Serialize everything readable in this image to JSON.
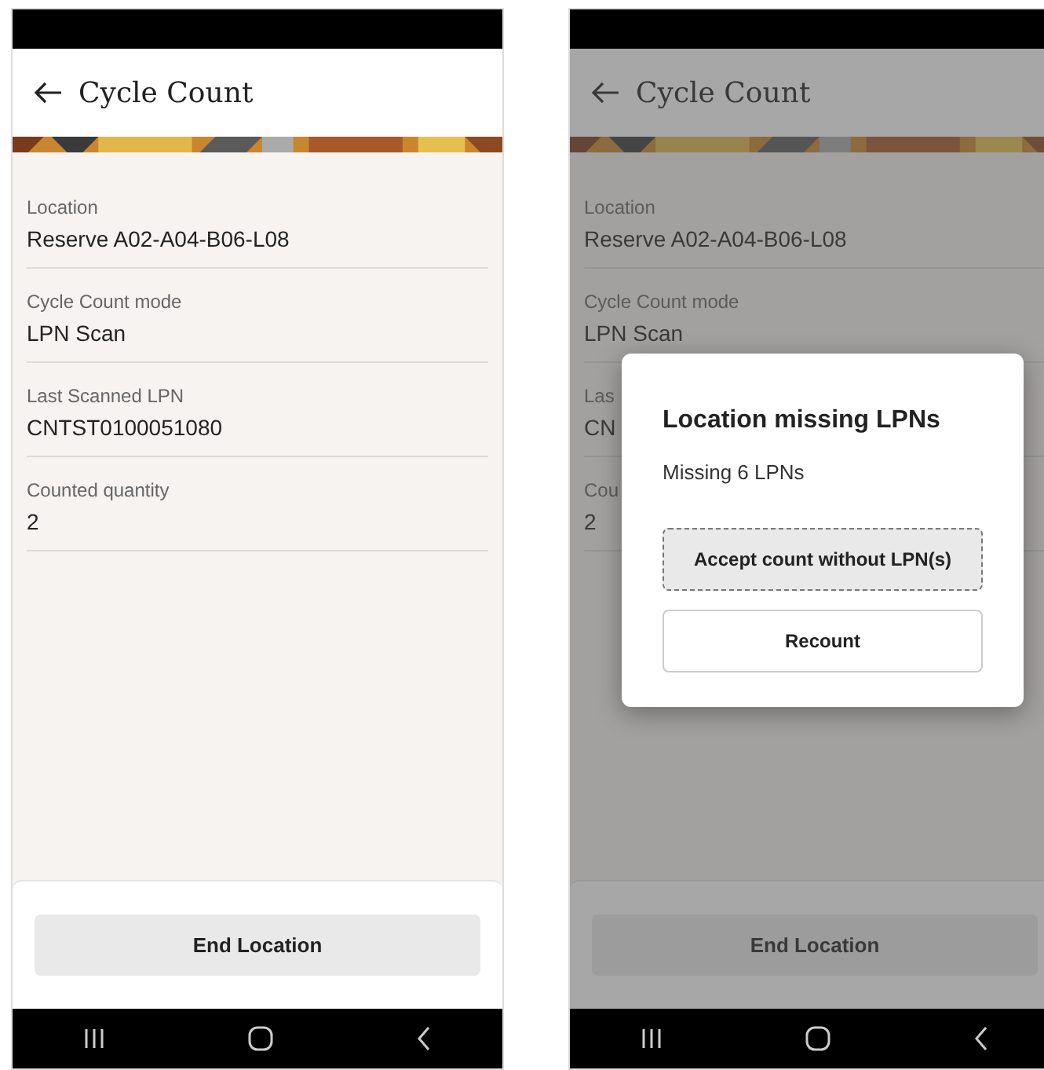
{
  "screens": [
    {
      "header": {
        "title": "Cycle Count"
      },
      "fields": [
        {
          "label": "Location",
          "value": "Reserve A02-A04-B06-L08"
        },
        {
          "label": "Cycle Count mode",
          "value": "LPN Scan"
        },
        {
          "label": "Last Scanned LPN",
          "value": "CNTST0100051080"
        },
        {
          "label": "Counted quantity",
          "value": "2"
        }
      ],
      "footer_button": "End Location"
    },
    {
      "header": {
        "title": "Cycle Count"
      },
      "fields": [
        {
          "label": "Location",
          "value": "Reserve A02-A04-B06-L08"
        },
        {
          "label": "Cycle Count mode",
          "value": "LPN Scan"
        },
        {
          "label": "Las",
          "value": "CN"
        },
        {
          "label": "Cou",
          "value": "2"
        }
      ],
      "footer_button": "End Location",
      "dialog": {
        "title": "Location missing LPNs",
        "message": "Missing 6 LPNs",
        "buttons": [
          {
            "label": "Accept count without LPN(s)",
            "focused": true
          },
          {
            "label": "Recount",
            "focused": false
          }
        ]
      }
    }
  ]
}
